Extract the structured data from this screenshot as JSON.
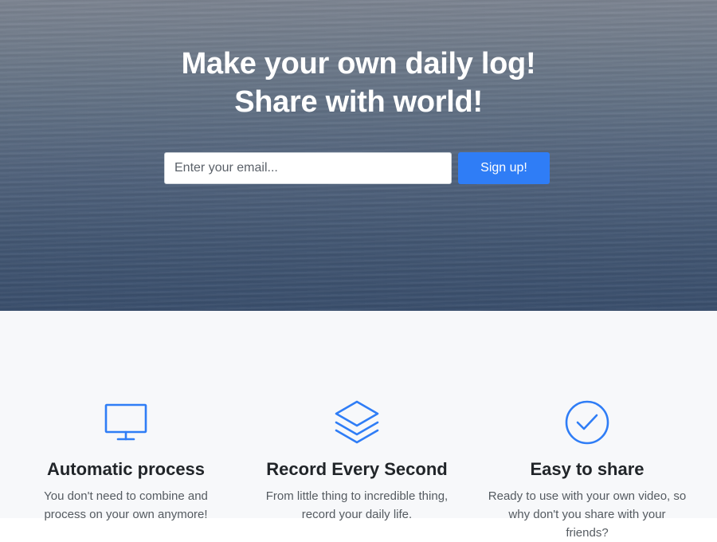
{
  "hero": {
    "title_line1": "Make your own daily log!",
    "title_line2": "Share with world!",
    "email_placeholder": "Enter your email...",
    "signup_label": "Sign up!"
  },
  "features": [
    {
      "icon": "monitor-icon",
      "title": "Automatic process",
      "text": "You don't need to combine and process on your own anymore!"
    },
    {
      "icon": "layers-icon",
      "title": "Record Every Second",
      "text": "From little thing to incredible thing, record your daily life."
    },
    {
      "icon": "check-circle-icon",
      "title": "Easy to share",
      "text": "Ready to use with your own video, so why don't you share with your friends?"
    }
  ],
  "colors": {
    "accent": "#2f7df6",
    "features_bg": "#f7f8fa",
    "title_text": "#212529",
    "body_text": "#555b61"
  }
}
